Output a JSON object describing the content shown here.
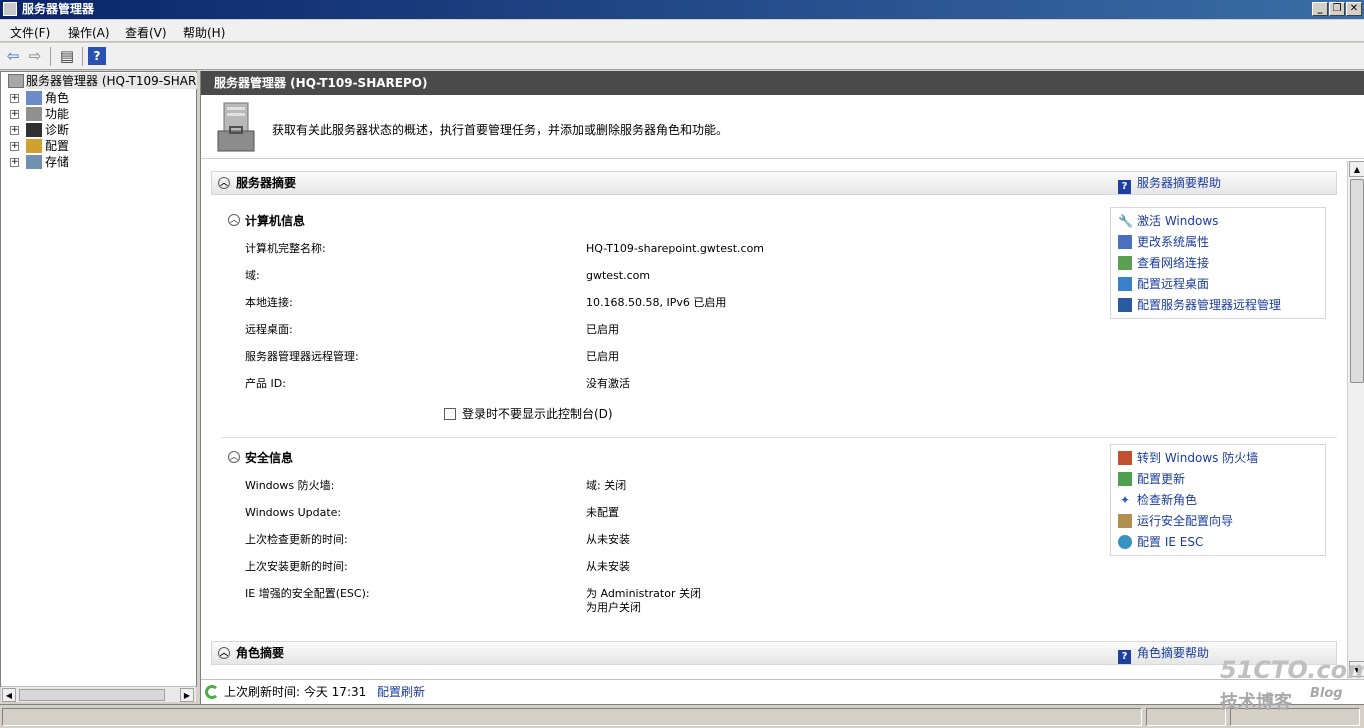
{
  "window": {
    "title": "服务器管理器",
    "min": "_",
    "max": "❐",
    "close": "✕"
  },
  "menu": [
    "文件(F)",
    "操作(A)",
    "查看(V)",
    "帮助(H)"
  ],
  "toolbar": {
    "back": "⇦",
    "forward": "⇨",
    "show_hide": "▤",
    "help": "?"
  },
  "tree": {
    "root": "服务器管理器 (HQ-T109-SHAREP",
    "items": [
      "角色",
      "功能",
      "诊断",
      "配置",
      "存储"
    ],
    "expander": "+"
  },
  "main": {
    "header": "服务器管理器 (HQ-T109-SHAREPO)",
    "description": "获取有关此服务器状态的概述，执行首要管理任务，并添加或删除服务器角色和功能。"
  },
  "server_summary": {
    "title": "服务器摘要",
    "help": "服务器摘要帮助",
    "computer_info": {
      "title": "计算机信息",
      "rows": [
        {
          "label": "计算机完整名称:",
          "value": "HQ-T109-sharepoint.gwtest.com"
        },
        {
          "label": "域:",
          "value": "gwtest.com"
        },
        {
          "label": "本地连接:",
          "value": "10.168.50.58, IPv6 已启用"
        },
        {
          "label": "远程桌面:",
          "value": "已启用"
        },
        {
          "label": "服务器管理器远程管理:",
          "value": "已启用"
        },
        {
          "label": "产品 ID:",
          "value": "没有激活"
        }
      ],
      "checkbox": "登录时不要显示此控制台(D)",
      "links": [
        "激活 Windows",
        "更改系统属性",
        "查看网络连接",
        "配置远程桌面",
        "配置服务器管理器远程管理"
      ]
    },
    "security_info": {
      "title": "安全信息",
      "rows": [
        {
          "label": "Windows 防火墙:",
          "value": "域: 关闭"
        },
        {
          "label": "Windows Update:",
          "value": "未配置"
        },
        {
          "label": "上次检查更新的时间:",
          "value": "从未安装"
        },
        {
          "label": "上次安装更新的时间:",
          "value": "从未安装"
        },
        {
          "label": "IE 增强的安全配置(ESC):",
          "value": "为 Administrator 关闭",
          "value2": "为用户关闭"
        }
      ],
      "links": [
        "转到 Windows 防火墙",
        "配置更新",
        "检查新角色",
        "运行安全配置向导",
        "配置 IE ESC"
      ]
    }
  },
  "roles_summary": {
    "title": "角色摘要",
    "help": "角色摘要帮助"
  },
  "refresh": {
    "label": "上次刷新时间: 今天 17:31",
    "link": "配置刷新"
  },
  "watermark": {
    "line1": "51CTO.com",
    "line2": "技术博客",
    "line3": "Blog"
  }
}
